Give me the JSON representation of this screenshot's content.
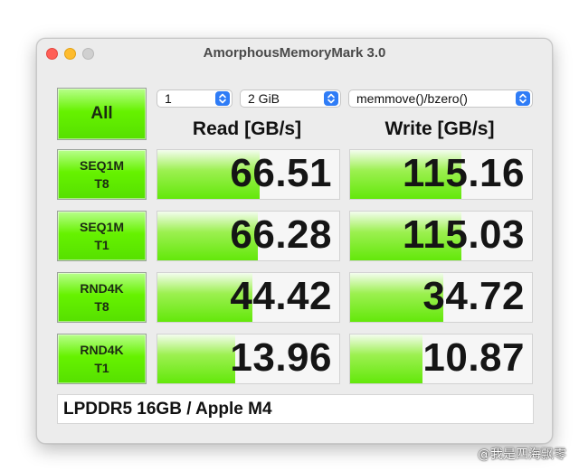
{
  "window": {
    "title": "AmorphousMemoryMark 3.0"
  },
  "controls": {
    "all_label": "All",
    "count_select": "1",
    "size_select": "2 GiB",
    "mode_select": "memmove()/bzero()"
  },
  "headers": {
    "read": "Read [GB/s]",
    "write": "Write [GB/s]"
  },
  "tests": [
    {
      "line1": "SEQ1M",
      "line2": "T8",
      "read": "66.51",
      "write": "115.16",
      "read_fill": 0.56,
      "write_fill": 0.61
    },
    {
      "line1": "SEQ1M",
      "line2": "T1",
      "read": "66.28",
      "write": "115.03",
      "read_fill": 0.55,
      "write_fill": 0.61
    },
    {
      "line1": "RND4K",
      "line2": "T8",
      "read": "44.42",
      "write": "34.72",
      "read_fill": 0.52,
      "write_fill": 0.51
    },
    {
      "line1": "RND4K",
      "line2": "T1",
      "read": "13.96",
      "write": "10.87",
      "read_fill": 0.43,
      "write_fill": 0.4
    }
  ],
  "footer": {
    "text": "LPDDR5 16GB / Apple M4"
  },
  "watermark": "@我是四海飘零",
  "colors": {
    "button_green": "#66f200",
    "bar_green": "#63e80a",
    "select_arrow": "#2f7cf6"
  }
}
